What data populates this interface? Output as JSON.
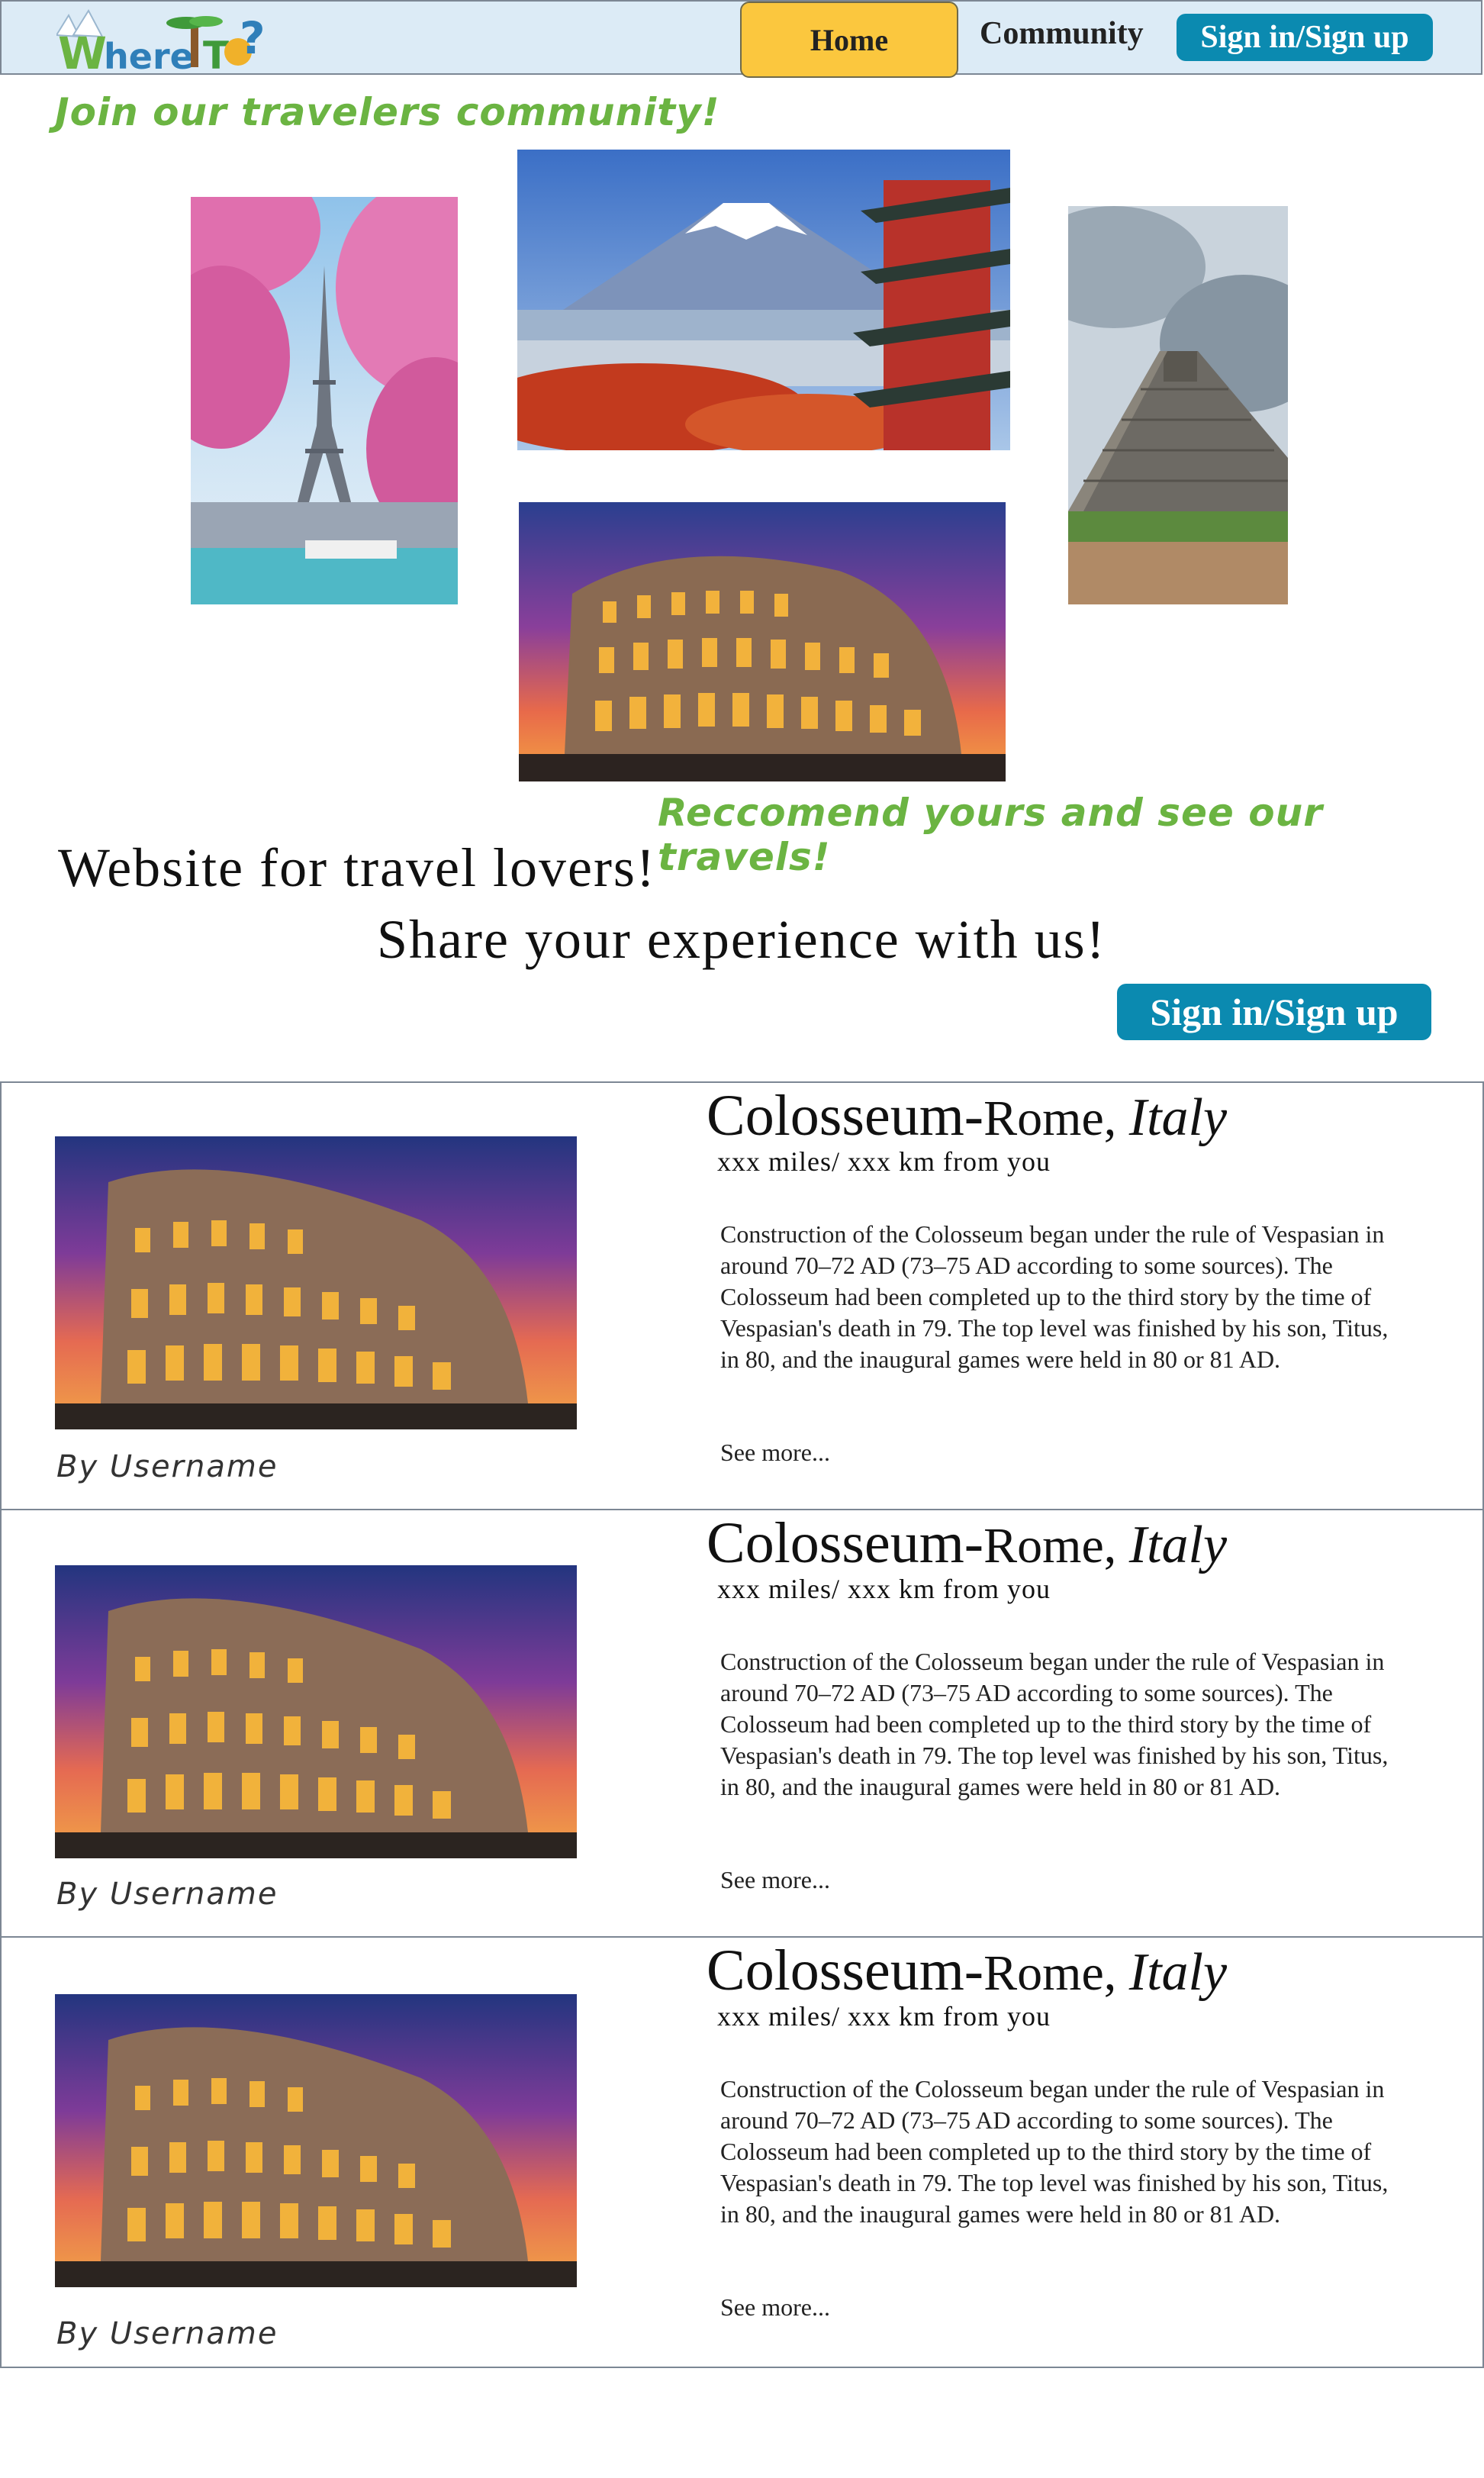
{
  "nav": {
    "logo_text": "WhereTo?",
    "home_label": "Home",
    "community_label": "Community",
    "signin_label": "Sign in/Sign up"
  },
  "hero": {
    "join_text": "Join our travelers community!",
    "recommend_text": "Reccomend yours and see our travels!",
    "line1": "Website for travel lovers!",
    "line2": "Share your experience with us!",
    "signin_label": "Sign in/Sign up"
  },
  "posts": [
    {
      "title_place": "Colosseum-",
      "title_city": "Rome, ",
      "title_country": "Italy",
      "distance": "xxx miles/ xxx km from you",
      "description": "Construction of  the Colosseum began under the rule of Vespasian in around 70–72 AD (73–75 AD according to some sources). The Colosseum had been completed up to the third story by the time of  Vespasian's death in 79. The top level was finished by his son, Titus, in 80, and the inaugural games were held in 80 or 81 AD.",
      "see_more": "See more...",
      "author": "By Username"
    },
    {
      "title_place": "Colosseum-",
      "title_city": "Rome, ",
      "title_country": "Italy",
      "distance": "xxx miles/ xxx km from you",
      "description": "Construction of  the Colosseum began under the rule of Vespasian in around 70–72 AD (73–75 AD according to some sources). The Colosseum had been completed up to the third story by the time of  Vespasian's death in 79. The top level was finished by his son, Titus, in 80, and the inaugural games were held in 80 or 81 AD.",
      "see_more": "See more...",
      "author": "By Username"
    },
    {
      "title_place": "Colosseum-",
      "title_city": "Rome, ",
      "title_country": "Italy",
      "distance": "xxx miles/ xxx km from you",
      "description": "Construction of  the Colosseum began under the rule of Vespasian in around 70–72 AD (73–75 AD according to some sources). The Colosseum had been completed up to the third story by the time of  Vespasian's death in 79. The top level was finished by his son, Titus, in 80, and the inaugural games were held in 80 or 81 AD.",
      "see_more": "See more...",
      "author": "By Username"
    }
  ],
  "colors": {
    "nav_bg": "#dcebf6",
    "home_button": "#fbc73e",
    "signin_button": "#0b8ab0",
    "script_green": "#6bb442"
  }
}
